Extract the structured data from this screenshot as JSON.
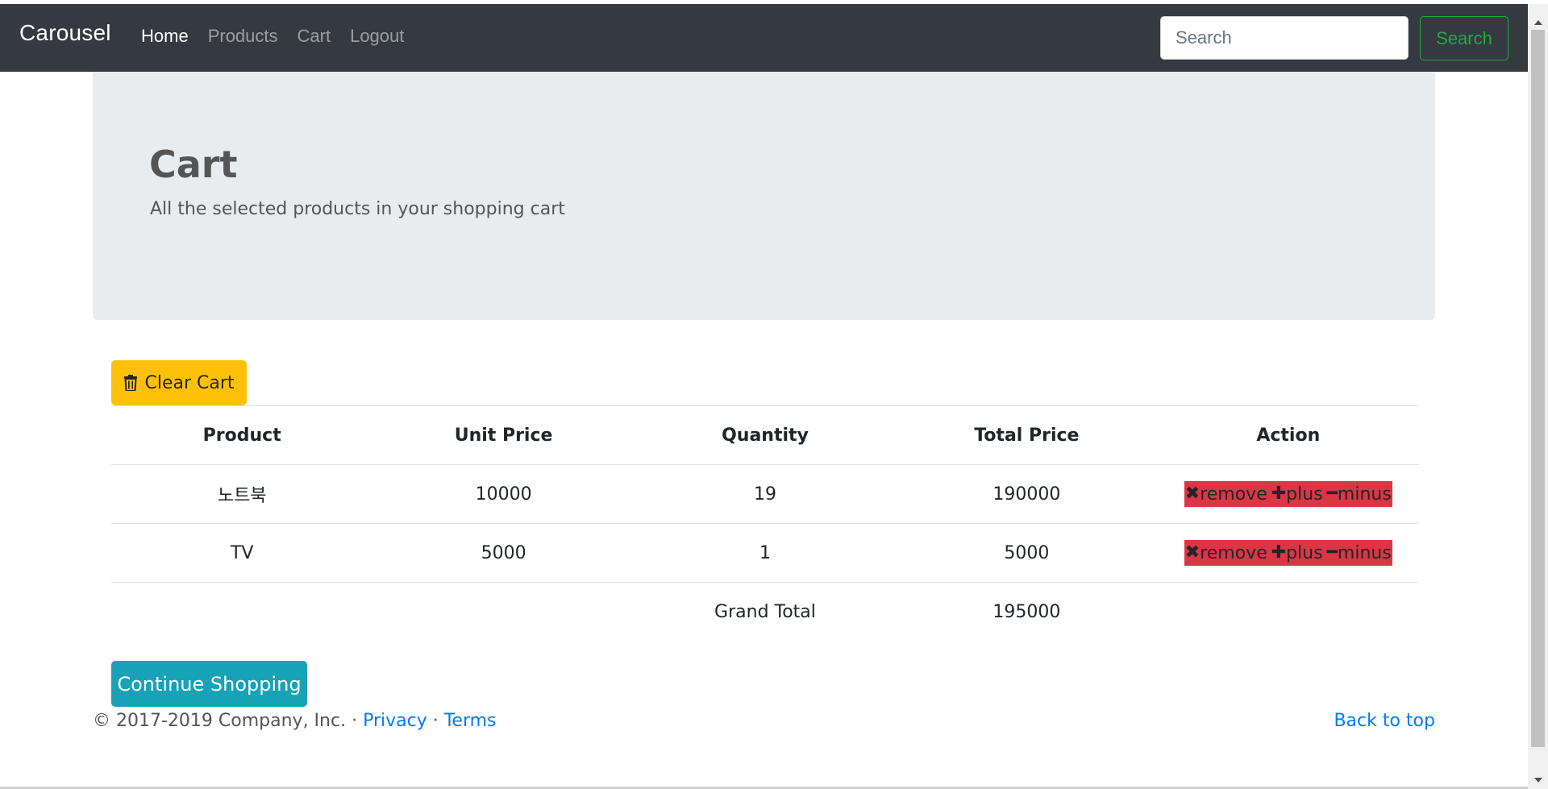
{
  "navbar": {
    "brand": "Carousel",
    "links": [
      {
        "label": "Home",
        "active": true
      },
      {
        "label": "Products",
        "active": false
      },
      {
        "label": "Cart",
        "active": false
      },
      {
        "label": "Logout",
        "active": false
      }
    ],
    "search_placeholder": "Search",
    "search_button": "Search"
  },
  "jumbotron": {
    "title": "Cart",
    "subtitle": "All the selected products in your shopping cart"
  },
  "clear_cart": {
    "label": "Clear Cart",
    "icon": "trash-icon"
  },
  "table": {
    "headers": [
      "Product",
      "Unit Price",
      "Quantity",
      "Total Price",
      "Action"
    ],
    "rows": [
      {
        "product": "노트북",
        "unit_price": "10000",
        "quantity": "19",
        "total_price": "190000"
      },
      {
        "product": "TV",
        "unit_price": "5000",
        "quantity": "1",
        "total_price": "5000"
      }
    ],
    "actions": {
      "remove": "remove",
      "plus": "plus",
      "minus": "minus",
      "remove_icon": "✖",
      "plus_icon": "✚",
      "minus_icon": "━"
    },
    "grand_total_label": "Grand Total",
    "grand_total_value": "195000"
  },
  "continue_shopping": "Continue Shopping",
  "footer": {
    "copyright": "© 2017-2019 Company, Inc. ·",
    "privacy": "Privacy",
    "separator": "·",
    "terms": "Terms",
    "back_to_top": "Back to top"
  },
  "colors": {
    "navbar_bg": "#343a40",
    "jumbotron_bg": "#e9ecef",
    "warning": "#ffc107",
    "danger": "#dc3545",
    "info": "#17a2b8",
    "success": "#28a745",
    "link": "#007bff"
  }
}
